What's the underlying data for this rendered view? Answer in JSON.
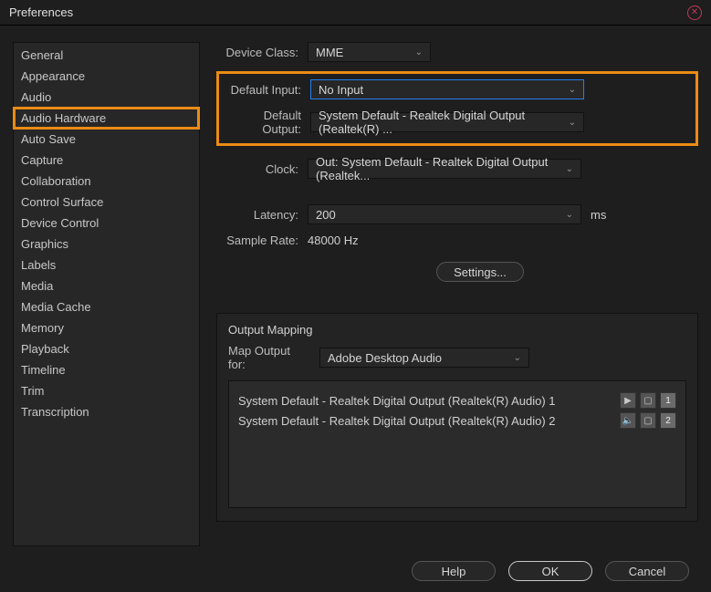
{
  "window": {
    "title": "Preferences"
  },
  "sidebar": {
    "items": [
      "General",
      "Appearance",
      "Audio",
      "Audio Hardware",
      "Auto Save",
      "Capture",
      "Collaboration",
      "Control Surface",
      "Device Control",
      "Graphics",
      "Labels",
      "Media",
      "Media Cache",
      "Memory",
      "Playback",
      "Timeline",
      "Trim",
      "Transcription"
    ],
    "active_index": 3
  },
  "form": {
    "device_class": {
      "label": "Device Class:",
      "value": "MME"
    },
    "default_input": {
      "label": "Default Input:",
      "value": "No Input"
    },
    "default_output": {
      "label": "Default Output:",
      "value": "System Default - Realtek Digital Output (Realtek(R) ..."
    },
    "clock": {
      "label": "Clock:",
      "value": "Out: System Default - Realtek Digital Output (Realtek..."
    },
    "latency": {
      "label": "Latency:",
      "value": "200",
      "unit": "ms"
    },
    "sample_rate": {
      "label": "Sample Rate:",
      "value": "48000 Hz"
    },
    "settings_btn": "Settings..."
  },
  "mapping": {
    "title": "Output Mapping",
    "map_output": {
      "label": "Map Output for:",
      "value": "Adobe Desktop Audio"
    },
    "rows": [
      {
        "name": "System Default - Realtek Digital Output (Realtek(R) Audio) 1",
        "num": "1"
      },
      {
        "name": "System Default - Realtek Digital Output (Realtek(R) Audio) 2",
        "num": "2"
      }
    ]
  },
  "footer": {
    "help": "Help",
    "ok": "OK",
    "cancel": "Cancel"
  }
}
